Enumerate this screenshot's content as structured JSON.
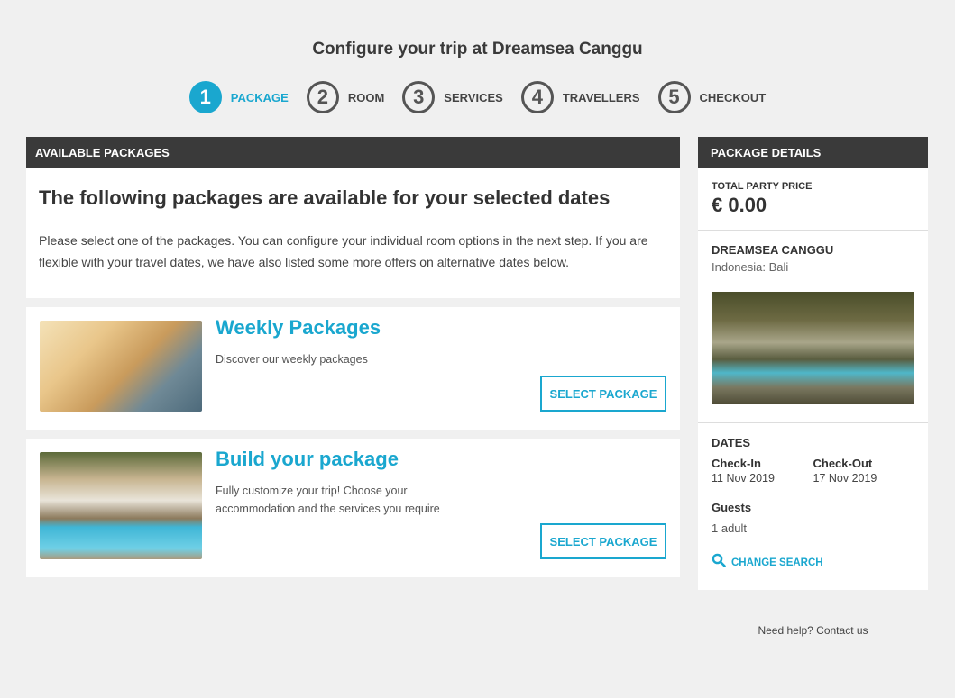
{
  "page_title": "Configure your trip at Dreamsea Canggu",
  "steps": [
    {
      "num": "1",
      "label": "PACKAGE"
    },
    {
      "num": "2",
      "label": "ROOM"
    },
    {
      "num": "3",
      "label": "SERVICES"
    },
    {
      "num": "4",
      "label": "TRAVELLERS"
    },
    {
      "num": "5",
      "label": "CHECKOUT"
    }
  ],
  "main": {
    "header": "AVAILABLE PACKAGES",
    "intro_title": "The following packages are available for your selected dates",
    "intro_text": "Please select one of the packages. You can configure your individual room options in the next step. If you are flexible with your travel dates, we have also listed some more offers on alternative dates below.",
    "packages": [
      {
        "title": "Weekly Packages",
        "desc": "Discover our weekly packages",
        "button": "SELECT PACKAGE"
      },
      {
        "title": "Build your package",
        "desc": "Fully customize your trip! Choose your accommodation and the services you require",
        "button": "SELECT PACKAGE"
      }
    ]
  },
  "side": {
    "header": "PACKAGE DETAILS",
    "price_label": "TOTAL PARTY PRICE",
    "price": "€ 0.00",
    "hotel_name": "DREAMSEA CANGGU",
    "hotel_location": "Indonesia: Bali",
    "dates_title": "DATES",
    "checkin_label": "Check-In",
    "checkin_value": "11 Nov 2019",
    "checkout_label": "Check-Out",
    "checkout_value": "17 Nov 2019",
    "guests_label": "Guests",
    "guests_value": "1 adult",
    "change_search": "CHANGE SEARCH"
  },
  "help_text": "Need help? Contact us",
  "colors": {
    "accent": "#1aa7cf",
    "header_bg": "#3a3a3a",
    "page_bg": "#f0f0f0"
  }
}
